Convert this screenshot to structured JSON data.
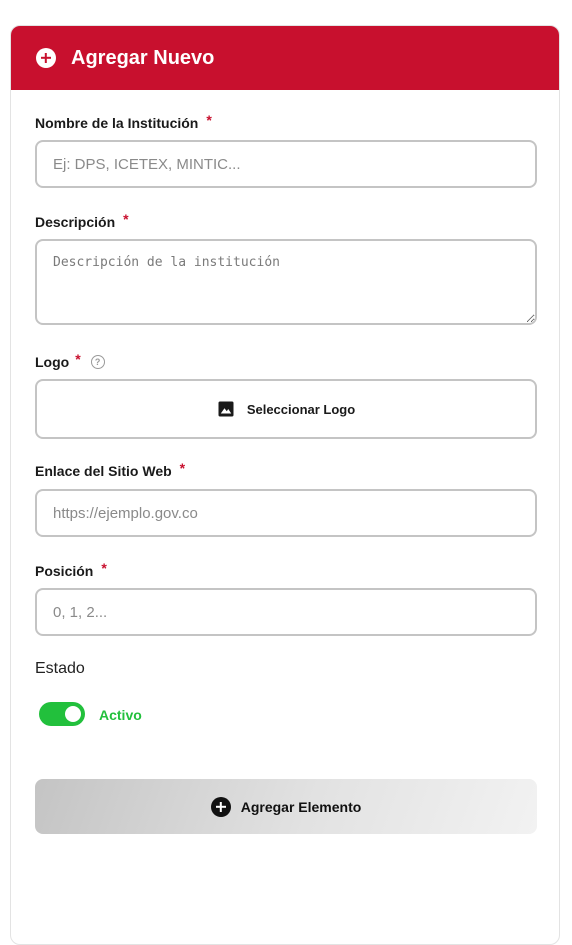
{
  "header": {
    "title": "Agregar Nuevo",
    "icon": "plus-circle-icon",
    "color": "#c8102e"
  },
  "form": {
    "institution": {
      "label": "Nombre de la Institución",
      "required_mark": "*",
      "value": "",
      "placeholder": "Ej: DPS, ICETEX, MINTIC..."
    },
    "description": {
      "label": "Descripción",
      "required_mark": "*",
      "value": "",
      "placeholder": "Descripción de la institución"
    },
    "logo": {
      "label": "Logo",
      "required_mark": "*",
      "help_icon": "help-circle-icon",
      "help_glyph": "?",
      "button_icon": "image-icon",
      "button_label": "Seleccionar Logo"
    },
    "website": {
      "label": "Enlace del Sitio Web",
      "required_mark": "*",
      "value": "",
      "placeholder": "https://ejemplo.gov.co"
    },
    "position": {
      "label": "Posición",
      "required_mark": "*",
      "value": "",
      "placeholder": "0, 1, 2..."
    },
    "status": {
      "label": "Estado",
      "toggle_on": true,
      "toggle_label": "Activo",
      "toggle_color": "#22c03c"
    },
    "submit": {
      "label": "Agregar Elemento",
      "icon": "plus-circle-icon"
    }
  }
}
